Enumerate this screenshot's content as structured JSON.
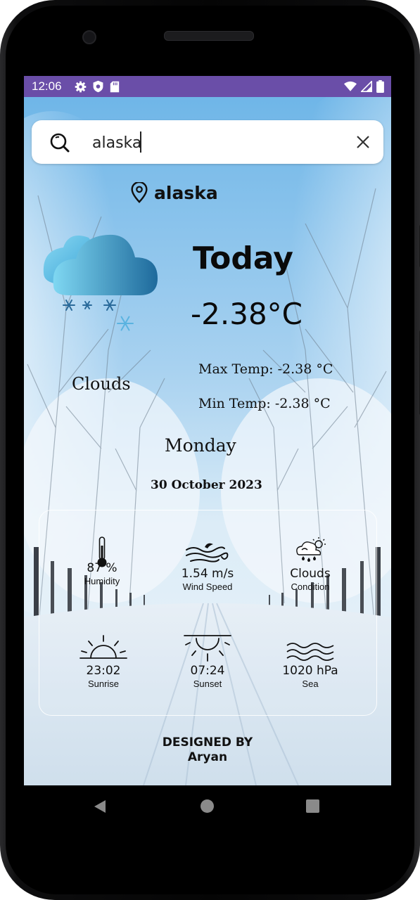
{
  "status_bar": {
    "time": "12:06",
    "icons_left": [
      "gear-icon",
      "shield-icon",
      "sd-card-icon"
    ],
    "icons_right": [
      "wifi-icon",
      "signal-icon",
      "battery-icon"
    ],
    "color": "#6a4ea8"
  },
  "search": {
    "value": "alaska",
    "icon": "search-icon",
    "clear_icon": "close-icon"
  },
  "location": {
    "icon": "location-pin-icon",
    "name": "alaska"
  },
  "weather": {
    "icon": "cloud-snow-icon",
    "heading": "Today",
    "temperature": "-2.38°C",
    "max_temp": "Max Temp: -2.38 °C",
    "min_temp": "Min Temp: -2.38 °C",
    "condition": "Clouds",
    "day": "Monday",
    "date": "30 October 2023"
  },
  "details": {
    "humidity": {
      "value": "87 %",
      "label": "Humidity",
      "icon": "thermometer-icon"
    },
    "wind": {
      "value": "1.54 m/s",
      "label": "Wind Speed",
      "icon": "wind-icon"
    },
    "condition": {
      "value": "Clouds",
      "label": "Condition",
      "icon": "cloudy-sun-icon"
    },
    "sunrise": {
      "value": "23:02",
      "label": "Sunrise",
      "icon": "sunrise-icon"
    },
    "sunset": {
      "value": "07:24",
      "label": "Sunset",
      "icon": "sunset-icon"
    },
    "sea": {
      "value": "1020 hPa",
      "label": "Sea",
      "icon": "waves-icon"
    }
  },
  "footer": {
    "line1": "DESIGNED BY",
    "line2": "Aryan"
  },
  "nav": {
    "icons": [
      "back-icon",
      "home-icon",
      "recents-icon"
    ]
  }
}
